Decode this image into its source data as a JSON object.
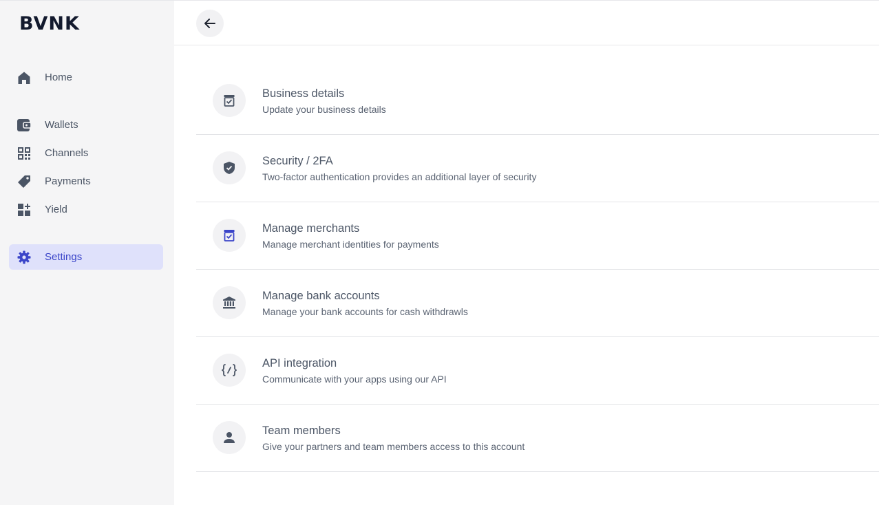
{
  "app": {
    "logo": "BVNK"
  },
  "sidebar": {
    "items": [
      {
        "label": "Home",
        "icon": "home-icon"
      },
      {
        "label": "Wallets",
        "icon": "wallet-icon"
      },
      {
        "label": "Channels",
        "icon": "qr-code-icon"
      },
      {
        "label": "Payments",
        "icon": "tag-icon"
      },
      {
        "label": "Yield",
        "icon": "dashboard-add-icon"
      },
      {
        "label": "Settings",
        "icon": "gear-icon",
        "active": true
      }
    ]
  },
  "header": {
    "back_icon": "arrow-left-icon"
  },
  "settings": {
    "items": [
      {
        "title": "Business details",
        "description": "Update your business details",
        "icon": "store-icon"
      },
      {
        "title": "Security / 2FA",
        "description": "Two-factor authentication provides an additional layer of security",
        "icon": "shield-check-icon"
      },
      {
        "title": "Manage merchants",
        "description": "Manage merchant identities for payments",
        "icon": "store-icon"
      },
      {
        "title": "Manage bank accounts",
        "description": "Manage your bank accounts for cash withdrawls",
        "icon": "bank-icon"
      },
      {
        "title": "API integration",
        "description": "Communicate with your apps using our API",
        "icon": "code-braces-icon"
      },
      {
        "title": "Team members",
        "description": "Give your partners and team members access to this account",
        "icon": "person-icon"
      }
    ]
  },
  "colors": {
    "sidebar_bg": "#f5f5f6",
    "active_bg": "#dfe1fb",
    "active_text": "#3b45c9",
    "text": "#4b5565",
    "logo": "#131a2e"
  }
}
